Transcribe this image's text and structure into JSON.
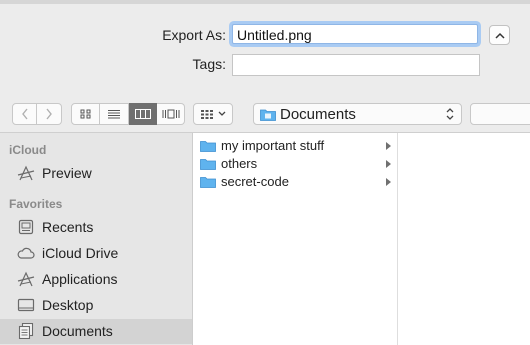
{
  "export_form": {
    "export_as_label": "Export As:",
    "filename_value": "Untitled.png",
    "tags_label": "Tags:",
    "tags_value": ""
  },
  "toolbar": {
    "back_icon": "chevron-left-icon",
    "forward_icon": "chevron-right-icon",
    "views": [
      "icon-view",
      "list-view",
      "column-view",
      "cover-flow-view"
    ],
    "active_view": "column-view",
    "location": "Documents"
  },
  "sidebar": {
    "sections": [
      {
        "title": "iCloud",
        "items": [
          {
            "label": "Preview",
            "icon": "preview-app-icon"
          }
        ]
      },
      {
        "title": "Favorites",
        "items": [
          {
            "label": "Recents",
            "icon": "recents-icon"
          },
          {
            "label": "iCloud Drive",
            "icon": "cloud-icon"
          },
          {
            "label": "Applications",
            "icon": "applications-icon"
          },
          {
            "label": "Desktop",
            "icon": "desktop-icon"
          },
          {
            "label": "Documents",
            "icon": "documents-icon",
            "selected": true
          }
        ]
      }
    ]
  },
  "browser": {
    "column_1": [
      {
        "name": "my important stuff",
        "kind": "folder"
      },
      {
        "name": "others",
        "kind": "folder"
      },
      {
        "name": "secret-code",
        "kind": "folder"
      }
    ]
  },
  "colors": {
    "focus_ring": "#a9cbf3",
    "folder_blue": "#5fb3ee",
    "selected_row": "#d3d3d3",
    "sidebar_bg": "#e6e6e6"
  }
}
